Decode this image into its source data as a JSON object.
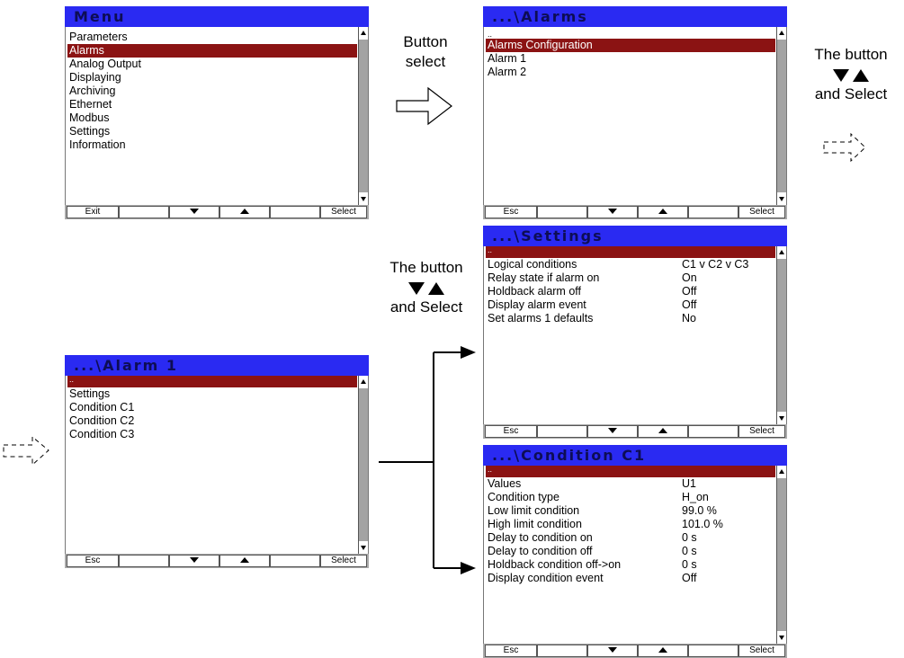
{
  "screens": {
    "menu": {
      "title": "Menu",
      "items": [
        "Parameters",
        "Alarms",
        "Analog Output",
        "Displaying",
        "Archiving",
        "Ethernet",
        "Modbus",
        "Settings",
        "Information"
      ],
      "softkeys": {
        "left": "Exit",
        "right": "Select"
      }
    },
    "alarms": {
      "title": "...\\Alarms",
      "items": [
        "..",
        "Alarms Configuration",
        "Alarm 1",
        "Alarm 2"
      ],
      "softkeys": {
        "left": "Esc",
        "right": "Select"
      }
    },
    "alarm1": {
      "title": "...\\Alarm 1",
      "items": [
        "..",
        "Settings",
        "Condition C1",
        "Condition C2",
        "Condition C3"
      ],
      "softkeys": {
        "left": "Esc",
        "right": "Select"
      }
    },
    "settings": {
      "title": "...\\Settings",
      "rows": [
        {
          "label": "..",
          "value": ""
        },
        {
          "label": "Logical conditions",
          "value": "C1 v C2 v C3"
        },
        {
          "label": "Relay state if alarm on",
          "value": "On"
        },
        {
          "label": "Holdback alarm off",
          "value": "Off"
        },
        {
          "label": "Display alarm event",
          "value": "Off"
        },
        {
          "label": "Set alarms 1 defaults",
          "value": "No"
        }
      ],
      "softkeys": {
        "left": "Esc",
        "right": "Select"
      }
    },
    "condition_c1": {
      "title": "...\\Condition C1",
      "rows": [
        {
          "label": "..",
          "value": ""
        },
        {
          "label": "Values",
          "value": "U1"
        },
        {
          "label": "Condition type",
          "value": "H_on"
        },
        {
          "label": "Low limit condition",
          "value": "99.0  %"
        },
        {
          "label": "High limit condition",
          "value": "101.0  %"
        },
        {
          "label": "Delay to condition on",
          "value": "0  s"
        },
        {
          "label": "Delay to condition off",
          "value": "0  s"
        },
        {
          "label": "Holdback condition off->on",
          "value": "0  s"
        },
        {
          "label": "Display condition event",
          "value": "Off"
        }
      ],
      "softkeys": {
        "left": "Esc",
        "right": "Select"
      }
    }
  },
  "captions": {
    "button_select_line1": "Button",
    "button_select_line2": "select",
    "nav_top_line1": "The button",
    "nav_top_line3": "and Select",
    "nav_mid_line1": "The button",
    "nav_mid_line3": "and Select"
  },
  "colors": {
    "title_bar": "#2a2af2",
    "title_text": "#0d0d55",
    "selection": "#8b1313",
    "scrollbar": "#a3a3a3",
    "softkey_bar": "#aaaaaa"
  }
}
